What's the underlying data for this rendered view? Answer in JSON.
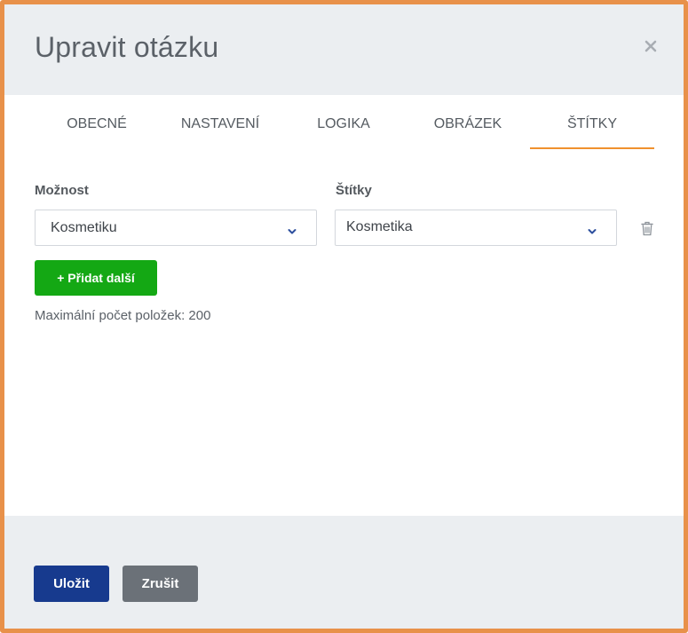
{
  "dialog": {
    "title": "Upravit otázku"
  },
  "tabs": [
    {
      "label": "OBECNÉ"
    },
    {
      "label": "NASTAVENÍ"
    },
    {
      "label": "LOGIKA"
    },
    {
      "label": "OBRÁZEK"
    },
    {
      "label": "ŠTÍTKY",
      "active": true
    }
  ],
  "form": {
    "option_label": "Možnost",
    "tags_label": "Štítky",
    "rows": [
      {
        "option": "Kosmetiku",
        "tag": "Kosmetika"
      }
    ],
    "add_label": "+ Přidat další",
    "max_items_hint": "Maximální počet položek: 200"
  },
  "footer": {
    "save_label": "Uložit",
    "cancel_label": "Zrušit"
  },
  "colors": {
    "accent_tab": "#f0912e",
    "frame": "#e8914a",
    "add_button": "#14a814",
    "save_button": "#173a8e",
    "cancel_button": "#6b7178"
  },
  "icons": {
    "close": "close-icon",
    "dropdown": "chevron-down-icon",
    "delete": "trash-icon"
  }
}
